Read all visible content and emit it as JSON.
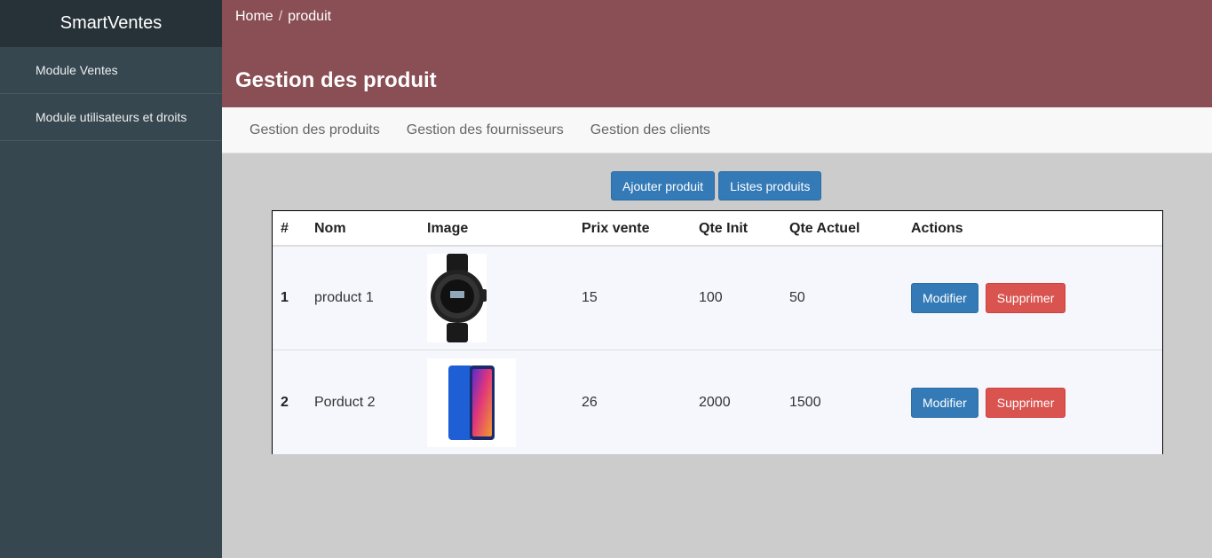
{
  "sidebar": {
    "brand": "SmartVentes",
    "items": [
      {
        "label": "Module Ventes"
      },
      {
        "label": "Module utilisateurs et droits"
      }
    ]
  },
  "header": {
    "breadcrumb": {
      "home": "Home",
      "separator": "/",
      "current": "produit"
    },
    "title": "Gestion des produit"
  },
  "tabs": [
    {
      "label": "Gestion des produits"
    },
    {
      "label": "Gestion des fournisseurs"
    },
    {
      "label": "Gestion des clients"
    }
  ],
  "toolbar": {
    "add_label": "Ajouter produit",
    "list_label": "Listes produits"
  },
  "table": {
    "columns": [
      "#",
      "Nom",
      "Image",
      "Prix vente",
      "Qte Init",
      "Qte Actuel",
      "Actions"
    ],
    "rows": [
      {
        "id": "1",
        "nom": "product 1",
        "image": "smartwatch-image",
        "prix": "15",
        "qte_init": "100",
        "qte_actuel": "50",
        "modify_label": "Modifier",
        "delete_label": "Supprimer"
      },
      {
        "id": "2",
        "nom": "Porduct 2",
        "image": "smartphone-image",
        "prix": "26",
        "qte_init": "2000",
        "qte_actuel": "1500",
        "modify_label": "Modifier",
        "delete_label": "Supprimer"
      }
    ]
  },
  "colors": {
    "sidebar_bg": "#37474f",
    "brand_bg": "#263238",
    "header_bg": "#8a4e55",
    "primary": "#337ab7",
    "danger": "#d9534f",
    "content_bg": "#cccccc"
  }
}
